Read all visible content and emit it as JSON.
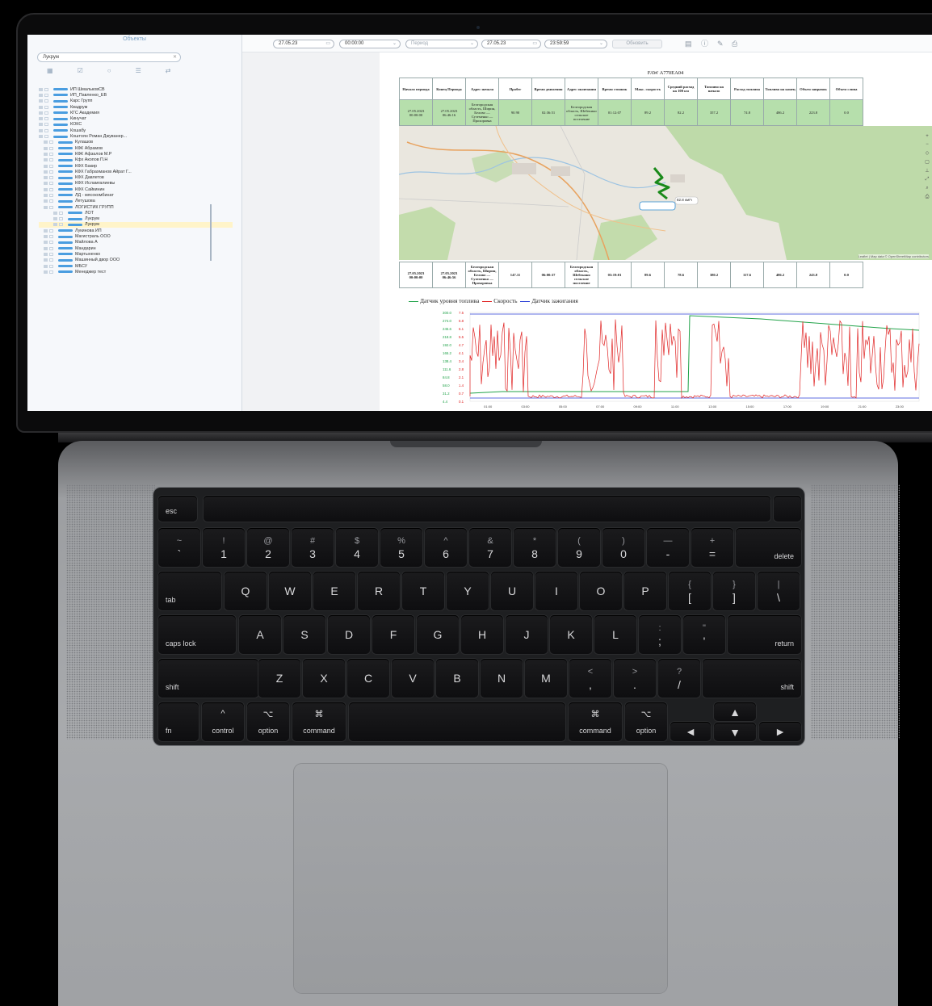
{
  "tree": {
    "title": "Объекты",
    "search_value": "Лукрум",
    "tool_icons": [
      "grid-icon",
      "checkbox-icon",
      "circle-icon",
      "list-icon",
      "link-icon"
    ],
    "items": [
      "ИП ШмальковСВ",
      "ИП_Павленко_ЕВ",
      "Карс Групп",
      "Квадрум",
      "КГС Академия",
      "Кинучат",
      "КОКС",
      "Кошабу",
      "Коштоян Роман Джуванер...",
      "Кулашов",
      "КФК Абрамов",
      "КФК Афзалов М.Р",
      "Кфх Акопов П.Н",
      "КФХ Бакир",
      "КФХ Габрахманов Айрат Г...",
      "КФХ Давлетов",
      "КФХ Исламгалиевы",
      "КФХ Сайкинин",
      "ЛД - мясокомбинат",
      "Летушова",
      "ЛОГИСТИК ГРУПП",
      "ЛОТ",
      "Лукрум",
      "Лукрум",
      "Лукинова ИП",
      "Магистраль ООО",
      "Майлова А",
      "Мандарин",
      "Мартыненко",
      "Машинный двор ООО",
      "МБСУ",
      "Менеджер тест"
    ],
    "selected_index": 23
  },
  "toolbar": {
    "date_from": "27.05.23",
    "time_from": "00:00:00",
    "period_placeholder": "Период",
    "date_to": "27.05.23",
    "time_to": "23:59:59",
    "refresh_label": "Обновить",
    "icons": [
      "calendar-icon",
      "info-icon",
      "edit-icon",
      "print-icon"
    ]
  },
  "report": {
    "title": "FAW А770ЕА04",
    "headers": [
      "Начало периода",
      "Конец Периода",
      "Адрес начала",
      "Пробег",
      "Время движения",
      "Адрес окончания",
      "Время стоянок",
      "Макс. скорость",
      "Средний расход на 100 км",
      "Топливо на начало",
      "Расход топлива",
      "Топливо на конец",
      "Объем заправок",
      "Объем слива"
    ],
    "row": [
      "27.05.2023 00:00:00",
      "27.05.2023 06:46:16",
      "Белгородская область, Ширин, Белово — Суземенко — Прохоровка",
      "90.90",
      "02:36:51",
      "Белгородская область, Шебекино сельское поселение",
      "01:12:07",
      "89.2",
      "82.2",
      "357.2",
      "74.8",
      "486.2",
      "223.8",
      "0.0"
    ],
    "total": [
      "27.05.2023 00:00:00",
      "27.05.2023 06:46:56",
      "Белгородская область, Ширин, Белово — Суземенко — Прохоровка",
      "147.11",
      "06:00:37",
      "Белгородская область, Шебекино сельское поселение",
      "03:19:01",
      "89.6",
      "78.6",
      "380.2",
      "117.6",
      "486.2",
      "243.8",
      "0.0"
    ]
  },
  "map": {
    "pin_label": "82.8 км/ч",
    "attribution": "Leaflet | Map data © OpenStreetMap contributors",
    "colors": {
      "land": "#eae7df",
      "forest": "#b9d8a3",
      "water": "#9cc3e2",
      "route": "#1a8a1a",
      "road": "#e8a25e"
    },
    "tool_icons": [
      "zoom-in-icon",
      "zoom-out-icon",
      "layers-icon",
      "measure-icon",
      "ruler-icon",
      "fullscreen-icon",
      "search-icon",
      "print-icon"
    ]
  },
  "chart_data": {
    "type": "line",
    "legend": [
      "Датчик уровня топлива",
      "Скорость",
      "Датчик зажигания"
    ],
    "colors": [
      "#22a34a",
      "#e02222",
      "#2b3fd6"
    ],
    "y_labels": [
      [
        "300.0",
        "7.5"
      ],
      [
        "274.0",
        "6.8"
      ],
      [
        "245.6",
        "6.1"
      ],
      [
        "218.8",
        "5.5"
      ],
      [
        "192.0",
        "4.7"
      ],
      [
        "165.2",
        "4.1"
      ],
      [
        "138.4",
        "3.4"
      ],
      [
        "111.6",
        "2.8"
      ],
      [
        "84.8",
        "2.1"
      ],
      [
        "58.0",
        "1.4"
      ],
      [
        "31.2",
        "0.7"
      ],
      [
        "4.4",
        "0.1"
      ]
    ],
    "x_labels": [
      "01:00",
      "03:00",
      "05:00",
      "07:00",
      "09:00",
      "11:00",
      "13:00",
      "15:00",
      "17:00",
      "19:00",
      "21:00",
      "23:00"
    ]
  },
  "keyboard": {
    "esc": "esc",
    "row1": [
      [
        "~",
        "`"
      ],
      [
        "!",
        "1"
      ],
      [
        "@",
        "2"
      ],
      [
        "#",
        "3"
      ],
      [
        "$",
        "4"
      ],
      [
        "%",
        "5"
      ],
      [
        "^",
        "6"
      ],
      [
        "&",
        "7"
      ],
      [
        "*",
        "8"
      ],
      [
        "(",
        "9"
      ],
      [
        ")",
        "0"
      ],
      [
        "—",
        "-"
      ],
      [
        "+",
        "="
      ]
    ],
    "delete": "delete",
    "tab": "tab",
    "row2": [
      "Q",
      "W",
      "E",
      "R",
      "T",
      "Y",
      "U",
      "I",
      "O",
      "P"
    ],
    "row2b": [
      [
        "{",
        "["
      ],
      [
        "}",
        "]"
      ],
      [
        "|",
        "\\"
      ]
    ],
    "caps": "caps lock",
    "row3": [
      "A",
      "S",
      "D",
      "F",
      "G",
      "H",
      "J",
      "K",
      "L"
    ],
    "row3b": [
      [
        ":",
        ";"
      ],
      [
        "\"",
        "'"
      ]
    ],
    "return": "return",
    "shift": "shift",
    "row4": [
      "Z",
      "X",
      "C",
      "V",
      "B",
      "N",
      "M"
    ],
    "row4b": [
      [
        "<",
        ","
      ],
      [
        ">",
        "."
      ],
      [
        "?",
        "/"
      ]
    ],
    "fn": "fn",
    "control": "control",
    "option": "option",
    "command": "command",
    "ctrl_sym": "^",
    "opt_sym": "⌥",
    "cmd_sym": "⌘",
    "arrows": [
      "◄",
      "▲",
      "▼",
      "►"
    ]
  }
}
